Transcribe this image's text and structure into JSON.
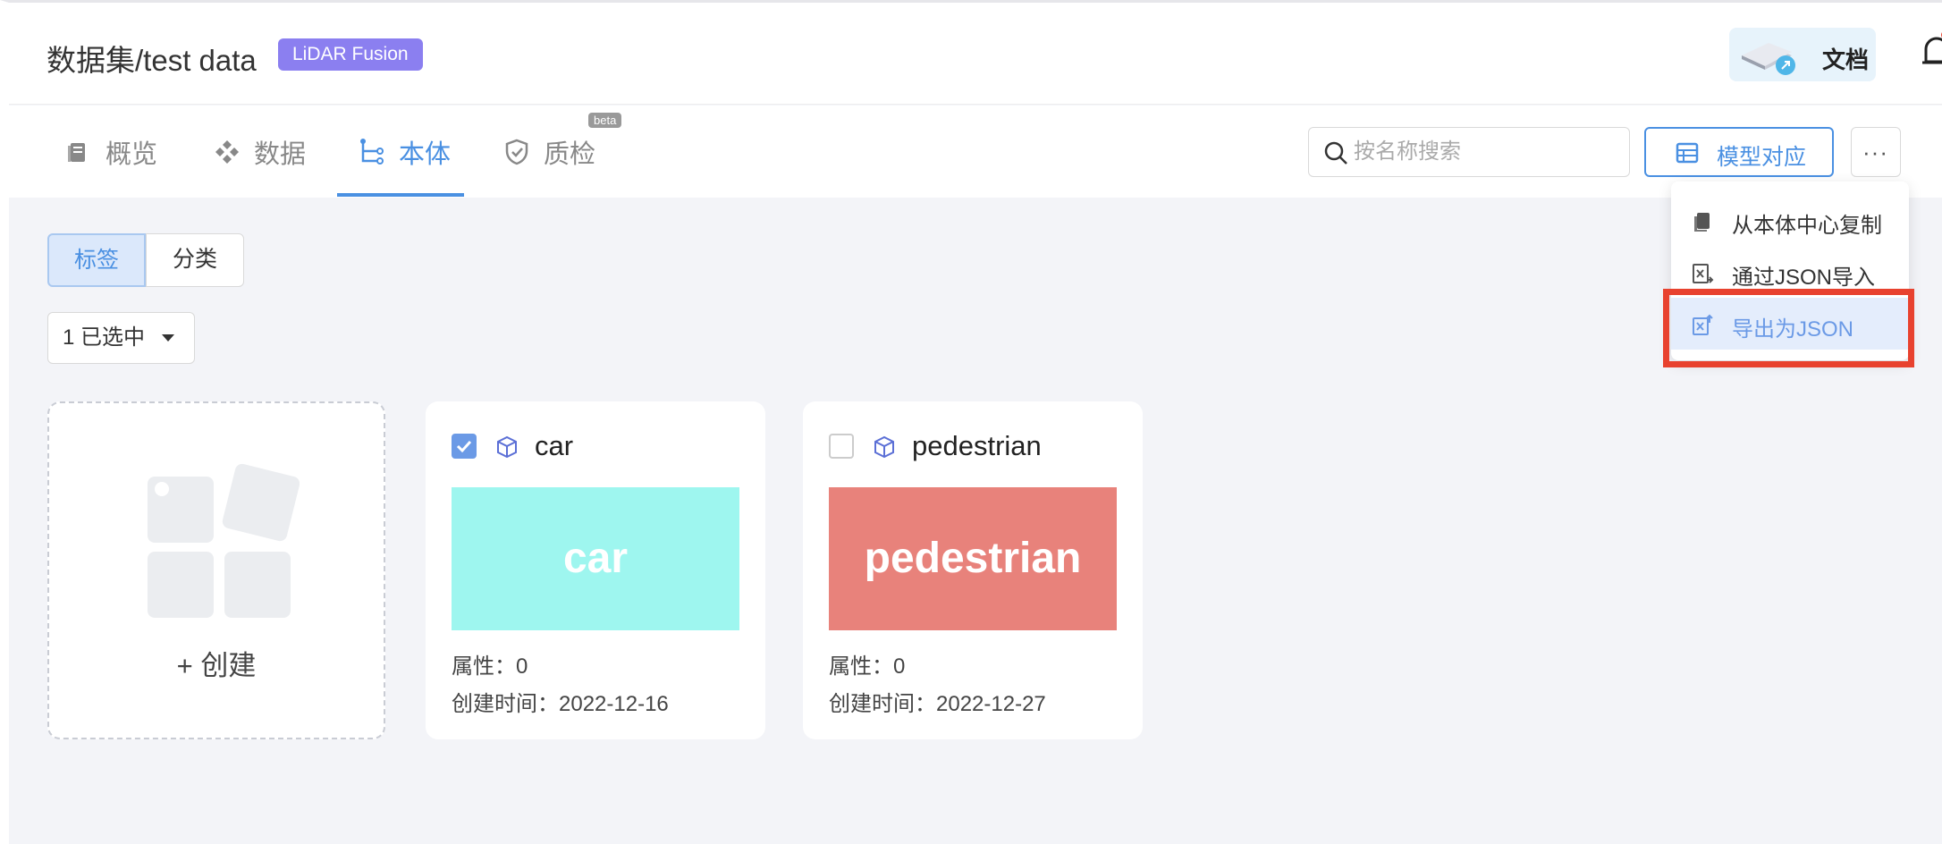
{
  "header": {
    "title": "数据集/test data",
    "badge": "LiDAR Fusion",
    "docs_label": "文档"
  },
  "tabs": [
    {
      "label": "概览",
      "icon": "document-stack-icon"
    },
    {
      "label": "数据",
      "icon": "diamond-grid-icon"
    },
    {
      "label": "本体",
      "icon": "tree-structure-icon",
      "active": true
    },
    {
      "label": "质检",
      "icon": "shield-check-icon",
      "tag": "beta"
    }
  ],
  "toolbar": {
    "search_placeholder": "按名称搜索",
    "model_button": "模型对应",
    "more_button": "···"
  },
  "segments": [
    "标签",
    "分类"
  ],
  "select": {
    "value": "1 已选中"
  },
  "create_card": {
    "label": "+ 创建"
  },
  "cards": [
    {
      "name": "car",
      "checked": true,
      "swatch_text": "car",
      "swatch_color": "#9ef6ef",
      "attributes": "属性：0",
      "created": "创建时间：2022-12-16"
    },
    {
      "name": "pedestrian",
      "checked": false,
      "swatch_text": "pedestrian",
      "swatch_color": "#e8827b",
      "attributes": "属性：0",
      "created": "创建时间：2022-12-27"
    }
  ],
  "dropdown": {
    "items": [
      "从本体中心复制",
      "通过JSON导入",
      "导出为JSON"
    ]
  },
  "colors": {
    "accent": "#4a90e2",
    "badge": "#8b7ff0",
    "highlight": "#e8422f"
  }
}
